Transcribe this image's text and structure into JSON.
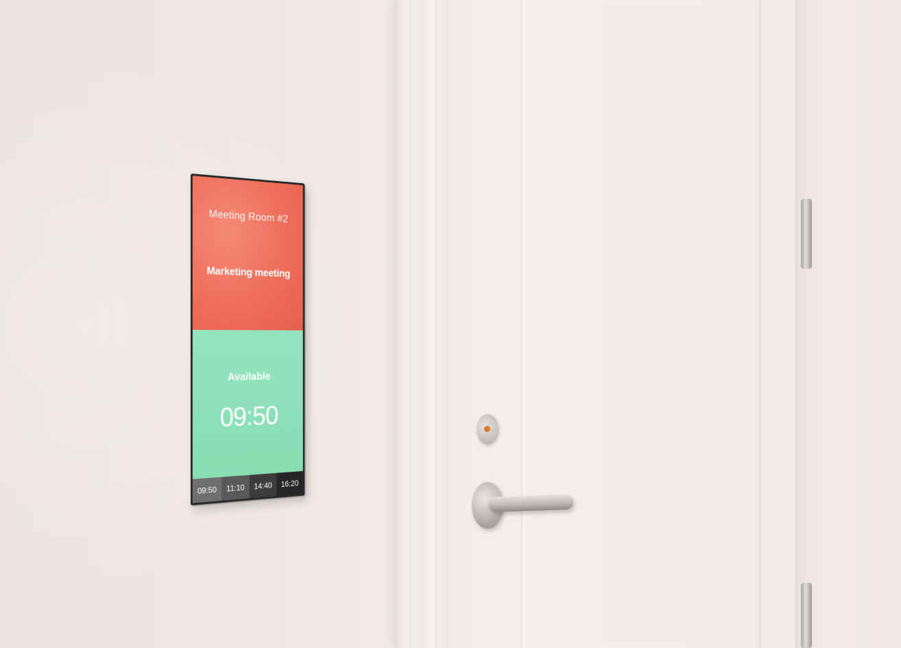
{
  "display": {
    "room_name": "Meeting Room #2",
    "current_meeting": "Marketing meeting",
    "status": "Available",
    "status_time": "09:50",
    "timeline": [
      "09:50",
      "11:10",
      "14:40",
      "16:20"
    ],
    "colors": {
      "busy": "#ee6e5a",
      "available": "#8ee0b8",
      "timeline": [
        "#6f6f6f",
        "#595959",
        "#3c3c3c",
        "#262626"
      ]
    }
  },
  "door": {
    "lock_indicator_color": "#d9782f"
  }
}
